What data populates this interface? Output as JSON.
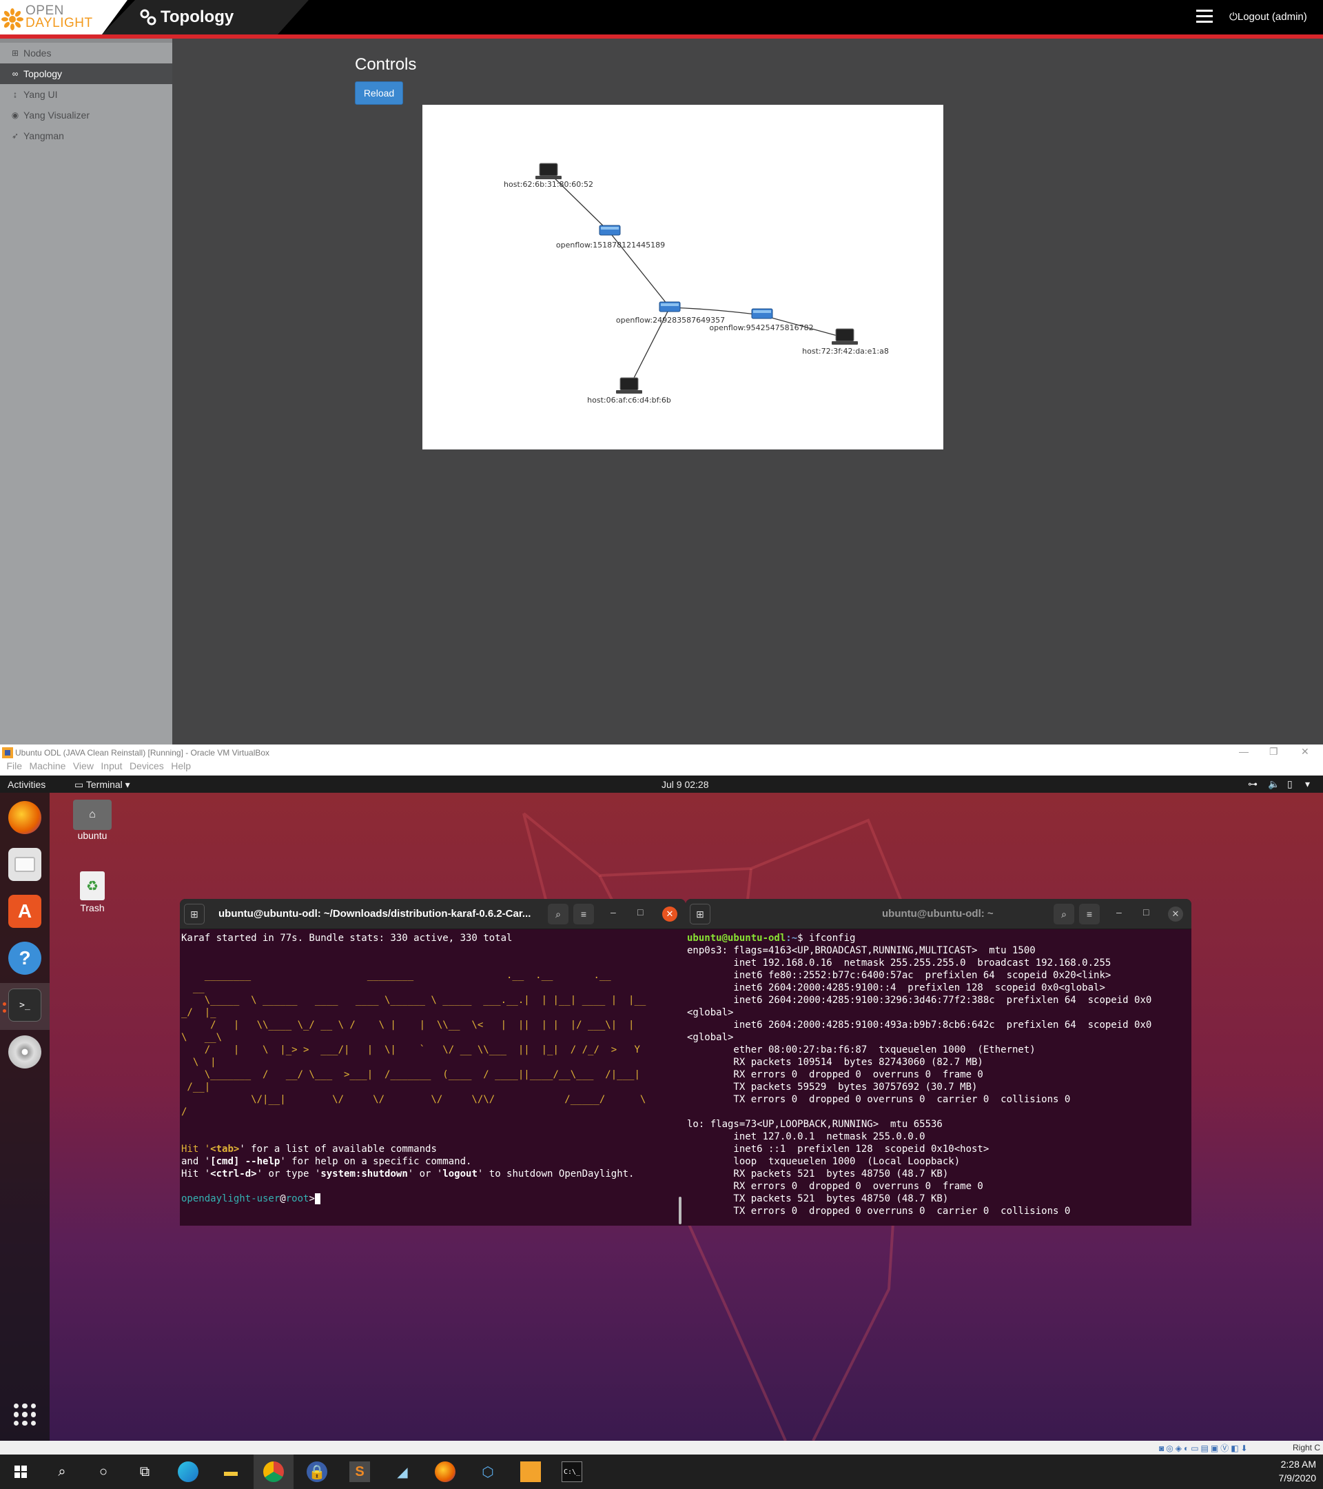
{
  "odl": {
    "logo_open": "OPEN",
    "logo_daylight": "DAYLIGHT",
    "page_title": "Topology",
    "logout_label": "Logout (admin)",
    "sidebar": [
      {
        "label": "Nodes",
        "icon": "sitemap-icon"
      },
      {
        "label": "Topology",
        "icon": "link-icon",
        "active": true
      },
      {
        "label": "Yang UI",
        "icon": "tree-icon"
      },
      {
        "label": "Yang Visualizer",
        "icon": "eye-icon"
      },
      {
        "label": "Yangman",
        "icon": "rocket-icon"
      }
    ],
    "controls_title": "Controls",
    "reload_label": "Reload",
    "topology": {
      "nodes": [
        {
          "id": "host:62:6b:31:80:60:52",
          "type": "host"
        },
        {
          "id": "openflow:151878121445189",
          "type": "switch"
        },
        {
          "id": "openflow:249283587649357",
          "type": "switch"
        },
        {
          "id": "openflow:95425475816782",
          "type": "switch"
        },
        {
          "id": "host:72:3f:42:da:e1:a8",
          "type": "host"
        },
        {
          "id": "host:06:af:c6:d4:bf:6b",
          "type": "host"
        }
      ]
    }
  },
  "vbox": {
    "title": "Ubuntu ODL (JAVA Clean Reinstall) [Running] - Oracle VM VirtualBox",
    "menu": [
      "File",
      "Machine",
      "View",
      "Input",
      "Devices",
      "Help"
    ],
    "host_key": "Right C"
  },
  "ubuntu": {
    "activities": "Activities",
    "app_menu": "Terminal",
    "clock": "Jul 9  02:28",
    "desktop_icons": [
      {
        "label": "ubuntu"
      },
      {
        "label": "Trash"
      }
    ]
  },
  "terminal_left": {
    "title": "ubuntu@ubuntu-odl: ~/Downloads/distribution-karaf-0.6.2-Car...",
    "banner_line": "Karaf started in 77s. Bundle stats: 330 active, 330 total",
    "ascii_art": "    ________                    ________                .__  .__       .__\n  __\n    \\_____  \\ ______   ____   ____ \\______ \\ _____  ___.__.|  | |__| ____ |  |__\n_/  |_\n     /   |   \\\\____ \\_/ __ \\ /    \\ |    |  \\\\__  \\<   |  ||  | |  |/ ___\\|  |\n\\   __\\\n    /    |    \\  |_> >  ___/|   |  \\|    `   \\/ __ \\\\___  ||  |_|  / /_/  >   Y\n  \\  |\n    \\_______  /   __/ \\___  >___|  /_______  (____  / ____||____/__\\___  /|___|\n /__|\n            \\/|__|        \\/     \\/        \\/     \\/\\/            /_____/      \\\n/",
    "help_line1_a": "Hit '",
    "help_line1_b": "<tab>",
    "help_line1_c": "' for a list of available commands",
    "help_line2_a": "and '",
    "help_line2_b": "[cmd] --help",
    "help_line2_c": "' for help on a specific command.",
    "help_line3_a": "Hit '",
    "help_line3_b": "<ctrl-d>",
    "help_line3_c": "' or type '",
    "help_line3_d": "system:shutdown",
    "help_line3_e": "' or '",
    "help_line3_f": "logout",
    "help_line3_g": "' to shutdown OpenDaylight.",
    "prompt_user": "opendaylight-user",
    "prompt_at": "@",
    "prompt_host": "root",
    "prompt_end": ">"
  },
  "terminal_right": {
    "title": "ubuntu@ubuntu-odl: ~",
    "prompt_user": "ubuntu@ubuntu-odl",
    "prompt_path": ":~",
    "prompt_cmd": "$ ifconfig",
    "output": "enp0s3: flags=4163<UP,BROADCAST,RUNNING,MULTICAST>  mtu 1500\n        inet 192.168.0.16  netmask 255.255.255.0  broadcast 192.168.0.255\n        inet6 fe80::2552:b77c:6400:57ac  prefixlen 64  scopeid 0x20<link>\n        inet6 2604:2000:4285:9100::4  prefixlen 128  scopeid 0x0<global>\n        inet6 2604:2000:4285:9100:3296:3d46:77f2:388c  prefixlen 64  scopeid 0x0\n<global>\n        inet6 2604:2000:4285:9100:493a:b9b7:8cb6:642c  prefixlen 64  scopeid 0x0\n<global>\n        ether 08:00:27:ba:f6:87  txqueuelen 1000  (Ethernet)\n        RX packets 109514  bytes 82743060 (82.7 MB)\n        RX errors 0  dropped 0  overruns 0  frame 0\n        TX packets 59529  bytes 30757692 (30.7 MB)\n        TX errors 0  dropped 0 overruns 0  carrier 0  collisions 0\n\nlo: flags=73<UP,LOOPBACK,RUNNING>  mtu 65536\n        inet 127.0.0.1  netmask 255.0.0.0\n        inet6 ::1  prefixlen 128  scopeid 0x10<host>\n        loop  txqueuelen 1000  (Local Loopback)\n        RX packets 521  bytes 48750 (48.7 KB)\n        RX errors 0  dropped 0  overruns 0  frame 0\n        TX packets 521  bytes 48750 (48.7 KB)\n        TX errors 0  dropped 0 overruns 0  carrier 0  collisions 0"
  },
  "windows": {
    "time": "2:28 AM",
    "date": "7/9/2020"
  }
}
